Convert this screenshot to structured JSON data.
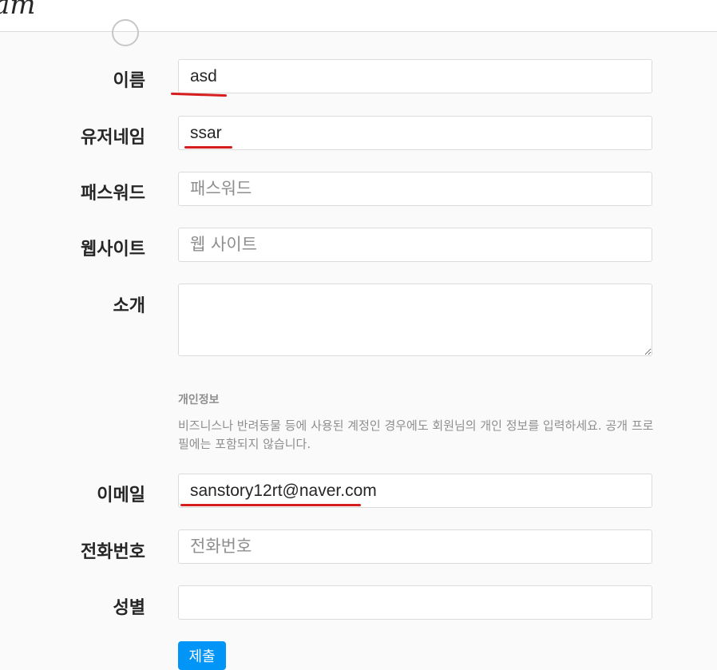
{
  "header": {
    "logo_text": "am"
  },
  "form": {
    "name": {
      "label": "이름",
      "value": "asd"
    },
    "username": {
      "label": "유저네임",
      "value": "ssar"
    },
    "password": {
      "label": "패스워드",
      "placeholder": "패스워드",
      "value": ""
    },
    "website": {
      "label": "웹사이트",
      "placeholder": "웹 사이트",
      "value": ""
    },
    "bio": {
      "label": "소개",
      "value": ""
    },
    "personal_info": {
      "title": "개인정보",
      "description": "비즈니스나 반려동물 등에 사용된 계정인 경우에도 회원님의 개인 정보를 입력하세요. 공개 프로필에는 포함되지 않습니다."
    },
    "email": {
      "label": "이메일",
      "value": "sanstory12rt@naver.com"
    },
    "phone": {
      "label": "전화번호",
      "placeholder": "전화번호",
      "value": ""
    },
    "gender": {
      "label": "성별",
      "value": ""
    },
    "submit_label": "제출"
  },
  "colors": {
    "accent": "#0095f6",
    "annotation": "#d71e1e",
    "border": "#dbdbdb",
    "background": "#fafafa"
  }
}
